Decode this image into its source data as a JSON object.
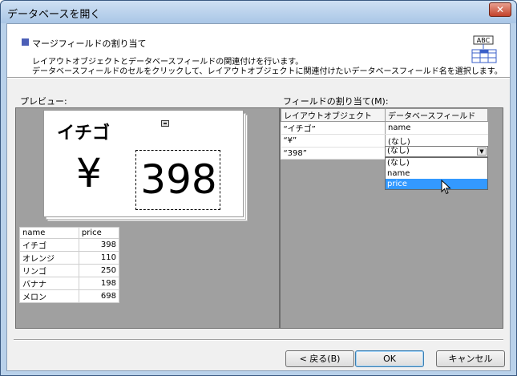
{
  "window": {
    "title": "データベースを開く",
    "close_symbol": "✕"
  },
  "header": {
    "title": "マージフィールドの割り当て",
    "description_1": "レイアウトオブジェクトとデータベースフィールドの関連付けを行います。",
    "description_2": "データベースフィールドのセルをクリックして、レイアウトオブジェクトに関連付けたいデータベースフィールド名を選択します。",
    "icon_text": "ABC",
    "icon": "field-assign-icon"
  },
  "preview": {
    "label": "プレビュー:",
    "label_objects": {
      "ichigo": "イチゴ",
      "yen": "¥",
      "price": "398"
    },
    "db_columns": [
      "name",
      "price"
    ],
    "db_rows": [
      [
        "イチゴ",
        "398"
      ],
      [
        "オレンジ",
        "110"
      ],
      [
        "リンゴ",
        "250"
      ],
      [
        "バナナ",
        "198"
      ],
      [
        "メロン",
        "698"
      ]
    ]
  },
  "field_assign": {
    "label": "フィールドの割り当て(M):",
    "columns": [
      "レイアウトオブジェクト",
      "データベースフィールド"
    ],
    "rows": [
      [
        "“イチゴ”",
        "name"
      ],
      [
        "“¥”",
        "(なし)"
      ],
      [
        "“398”",
        "(なし)"
      ]
    ],
    "combo_value": "(なし)",
    "dropdown_options": [
      "(なし)",
      "name",
      "price"
    ],
    "dropdown_highlight": "price"
  },
  "buttons": {
    "back": "< 戻る(B)",
    "ok": "OK",
    "cancel": "キャンセル"
  },
  "colors": {
    "title_bar": "#b9d1ea",
    "highlight": "#3399ff",
    "header_square": "#4c5fb7",
    "panel_bg": "#a0a0a0"
  }
}
